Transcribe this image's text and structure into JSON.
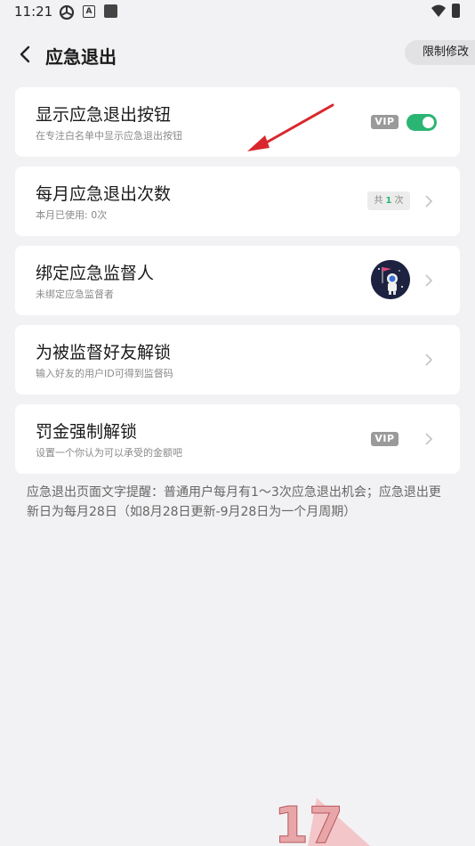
{
  "status_bar": {
    "time": "11:21",
    "icons": [
      "settings-icon",
      "app-a-icon",
      "square-icon",
      "wifi-icon",
      "battery-icon"
    ],
    "sb_a_letter": "A"
  },
  "header": {
    "title": "应急退出",
    "right_button": "限制修改"
  },
  "cards": [
    {
      "title": "显示应急退出按钮",
      "subtitle": "在专注白名单中显示应急退出按钮",
      "vip": "VIP",
      "toggle": true
    },
    {
      "title": "每月应急退出次数",
      "subtitle": "本月已使用: 0次",
      "badge_prefix": "共",
      "badge_count": "1",
      "badge_suffix": "次"
    },
    {
      "title": "绑定应急监督人",
      "subtitle": "未绑定应急监督者",
      "avatar": "astronaut-avatar"
    },
    {
      "title": "为被监督好友解锁",
      "subtitle": "输入好友的用户ID可得到监督码"
    },
    {
      "title": "罚金强制解锁",
      "subtitle": "设置一个你认为可以承受的金额吧",
      "vip": "VIP"
    }
  ],
  "notice": "应急退出页面文字提醒：普通用户每月有1～3次应急退出机会；应急退出更新日为每月28日（如8月28日更新-9月28日为一个月周期）",
  "watermark": "17",
  "colors": {
    "background": "#f2f2f4",
    "accent_green": "#2bb573",
    "vip_gray": "#9a9a9a",
    "arrow_red": "#d9272e"
  }
}
